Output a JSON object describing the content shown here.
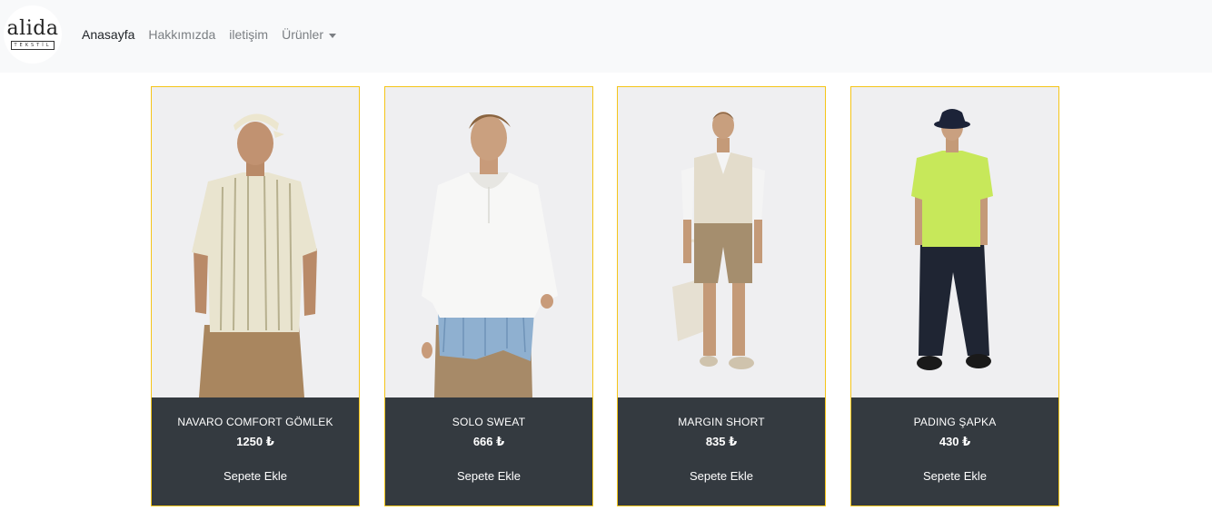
{
  "brand": {
    "name": "alida",
    "subtitle": "TEKSTİL"
  },
  "nav": {
    "items": [
      {
        "label": "Anasayfa",
        "active": true
      },
      {
        "label": "Hakkımızda",
        "active": false
      },
      {
        "label": "iletişim",
        "active": false
      },
      {
        "label": "Ürünler",
        "active": false,
        "dropdown": true
      }
    ]
  },
  "products": [
    {
      "name": "NAVARO COMFORT GÖMLEK",
      "price": "1250 ₺",
      "button": "Sepete Ekle"
    },
    {
      "name": "SOLO SWEAT",
      "price": "666 ₺",
      "button": "Sepete Ekle"
    },
    {
      "name": "MARGIN SHORT",
      "price": "835 ₺",
      "button": "Sepete Ekle"
    },
    {
      "name": "PADING ŞAPKA",
      "price": "430 ₺",
      "button": "Sepete Ekle"
    }
  ],
  "colors": {
    "navbar_bg": "#f8f9fa",
    "card_border": "#f5c518",
    "card_footer": "#343a40"
  }
}
